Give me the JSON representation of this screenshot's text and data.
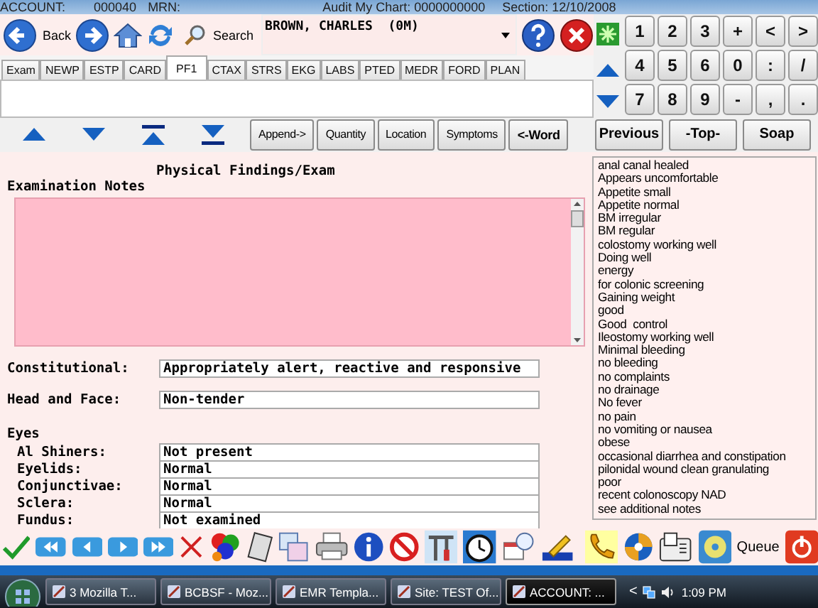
{
  "header": {
    "account_label": "ACCOUNT:",
    "account": "000040",
    "mrn_label": "MRN:",
    "audit": "Audit My Chart: 0000000000",
    "section": "Section: 12/10/2008"
  },
  "nav": {
    "back_label": "Back",
    "search_label": "Search",
    "patient": "BROWN, CHARLES  (0M)"
  },
  "keypad": [
    [
      "1",
      "2",
      "3",
      "+",
      "<",
      ">"
    ],
    [
      "4",
      "5",
      "6",
      "0",
      ":",
      "/"
    ],
    [
      "7",
      "8",
      "9",
      "-",
      ",",
      "."
    ]
  ],
  "tabs": [
    {
      "label": "Exam",
      "selected": false
    },
    {
      "label": "NEWP",
      "selected": false
    },
    {
      "label": "ESTP",
      "selected": false
    },
    {
      "label": "CARD",
      "selected": false
    },
    {
      "label": "PF1",
      "selected": true
    },
    {
      "label": "CTAX",
      "selected": false
    },
    {
      "label": "STRS",
      "selected": false
    },
    {
      "label": "EKG",
      "selected": false
    },
    {
      "label": "LABS",
      "selected": false
    },
    {
      "label": "PTED",
      "selected": false
    },
    {
      "label": "MEDR",
      "selected": false
    },
    {
      "label": "FORD",
      "selected": false
    },
    {
      "label": "PLAN",
      "selected": false
    }
  ],
  "word_buttons": [
    {
      "label": "Append->",
      "bold": false
    },
    {
      "label": "Quantity",
      "bold": false
    },
    {
      "label": "Location",
      "bold": false
    },
    {
      "label": "Symptoms",
      "bold": false
    },
    {
      "label": "<-Word",
      "bold": true
    }
  ],
  "nav_buttons": [
    "Previous",
    "-Top-",
    "Soap"
  ],
  "form": {
    "title": "Physical Findings/Exam",
    "notes_label": "Examination Notes",
    "rows": [
      {
        "kind": "field",
        "label": "Constitutional:",
        "value": "Appropriately alert, reactive and responsive"
      },
      {
        "kind": "field",
        "label": "Head and Face:",
        "value": "Non-tender"
      },
      {
        "kind": "heading",
        "label": "Eyes"
      },
      {
        "kind": "subfield",
        "label": "Al Shiners:",
        "value": "Not present"
      },
      {
        "kind": "subfield",
        "label": "Eyelids:",
        "value": "Normal"
      },
      {
        "kind": "subfield",
        "label": "Conjunctivae:",
        "value": "Normal"
      },
      {
        "kind": "subfield",
        "label": "Sclera:",
        "value": "Normal"
      },
      {
        "kind": "subfield",
        "label": "Fundus:",
        "value": "Not examined"
      }
    ]
  },
  "phrases": [
    "anal canal healed",
    "Appears uncomfortable",
    "Appetite small",
    "Appetite normal",
    "BM irregular",
    "BM regular",
    "colostomy working well",
    "Doing well",
    "energy",
    "for colonic screening",
    "Gaining weight",
    "good",
    "Good  control",
    "Ileostomy working well",
    "Minimal bleeding",
    "no bleeding",
    "no complaints",
    "no drainage",
    "No fever",
    "no pain",
    "no vomiting or nausea",
    "obese",
    "occasional diarrhea and constipation",
    "pilonidal wound clean granulating",
    "poor",
    "recent colonoscopy NAD",
    "see additional notes"
  ],
  "toolbar": {
    "queue_label": "Queue"
  },
  "taskbar": {
    "items": [
      {
        "label": "3 Mozilla T...",
        "selected": false
      },
      {
        "label": "BCBSF - Moz...",
        "selected": false
      },
      {
        "label": "EMR Templa...",
        "selected": false
      },
      {
        "label": "Site: TEST Of...",
        "selected": false
      },
      {
        "label": "ACCOUNT: ...",
        "selected": true
      }
    ],
    "tray_arrow": "<",
    "time": "1:09 PM"
  }
}
